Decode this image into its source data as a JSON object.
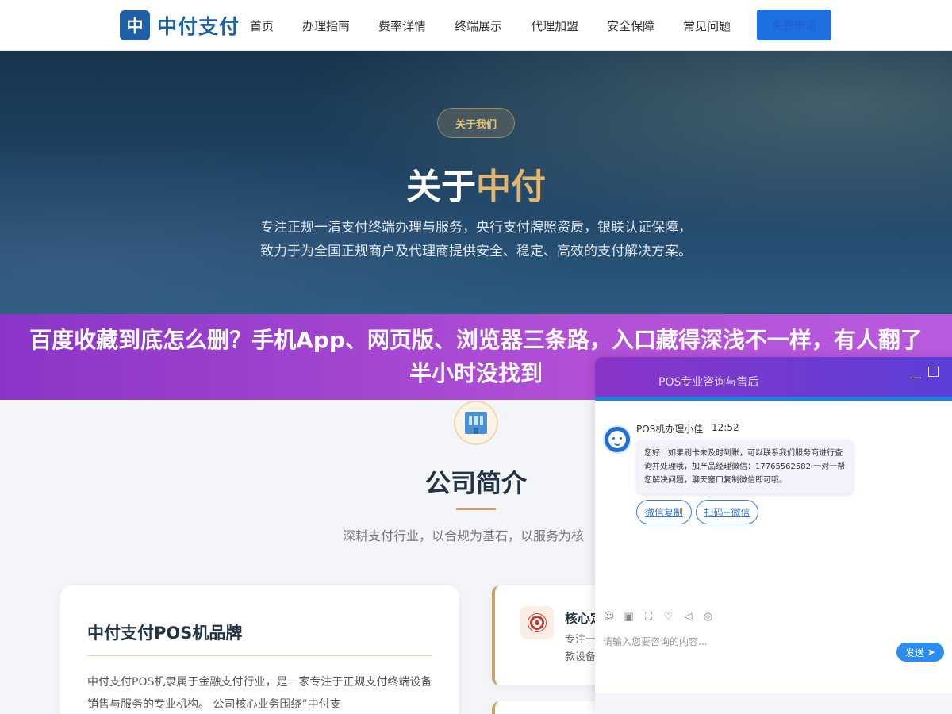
{
  "header": {
    "logo_mark": "中",
    "logo_text": "中付支付",
    "nav": [
      "首页",
      "办理指南",
      "费率详情",
      "终端展示",
      "代理加盟",
      "安全保障",
      "常见问题"
    ],
    "cta_label": "免费申请"
  },
  "hero": {
    "badge": "关于我们",
    "title_prefix": "关于",
    "title_highlight": "中付",
    "description": "专注正规一清支付终端办理与服务，央行支付牌照资质，银联认证保障， 致力于为全国正规商户及代理商提供安全、稳定、高效的支付解决方案。"
  },
  "banner": {
    "text": "百度收藏到底怎么删？手机App、网页版、浏览器三条路，入口藏得深浅不一样，有人翻了半小时没找到"
  },
  "company": {
    "icon": "building-icon",
    "title": "公司简介",
    "subtitle": "深耕支付行业，以合规为基石，以服务为核",
    "card_left": {
      "title": "中付支付POS机品牌",
      "text": "中付支付POS机隶属于金融支付行业，是一家专注于正规支付终端设备销售与服务的专业机构。 公司核心业务围绕“中付支"
    },
    "card_right": {
      "icon": "target-icon",
      "title": "核心定",
      "text_line1": "专注一",
      "text_line2": "款设备"
    }
  },
  "chat": {
    "header_title": "POS专业咨询与售后",
    "agent_name": "POS机办理小佳",
    "time": "12:52",
    "message": "您好！如果刷卡未及时到账，可以联系我们服务商进行查询并处理哦，加产品经理微信：17765562582 一对一帮您解决问题，聊天窗口复制微信即可哦。",
    "buttons": [
      "微信复制",
      "扫码+微信"
    ],
    "tools": [
      "emoji-icon",
      "image-icon",
      "screenshot-icon",
      "rating-icon",
      "voice-icon",
      "wechat-icon"
    ],
    "input_placeholder": "请输入您要咨询的内容...",
    "send_label": "发送",
    "colors": {
      "accent": "#2b8cf0",
      "header_start": "#8a35c8",
      "header_end": "#5b3fd8"
    }
  }
}
